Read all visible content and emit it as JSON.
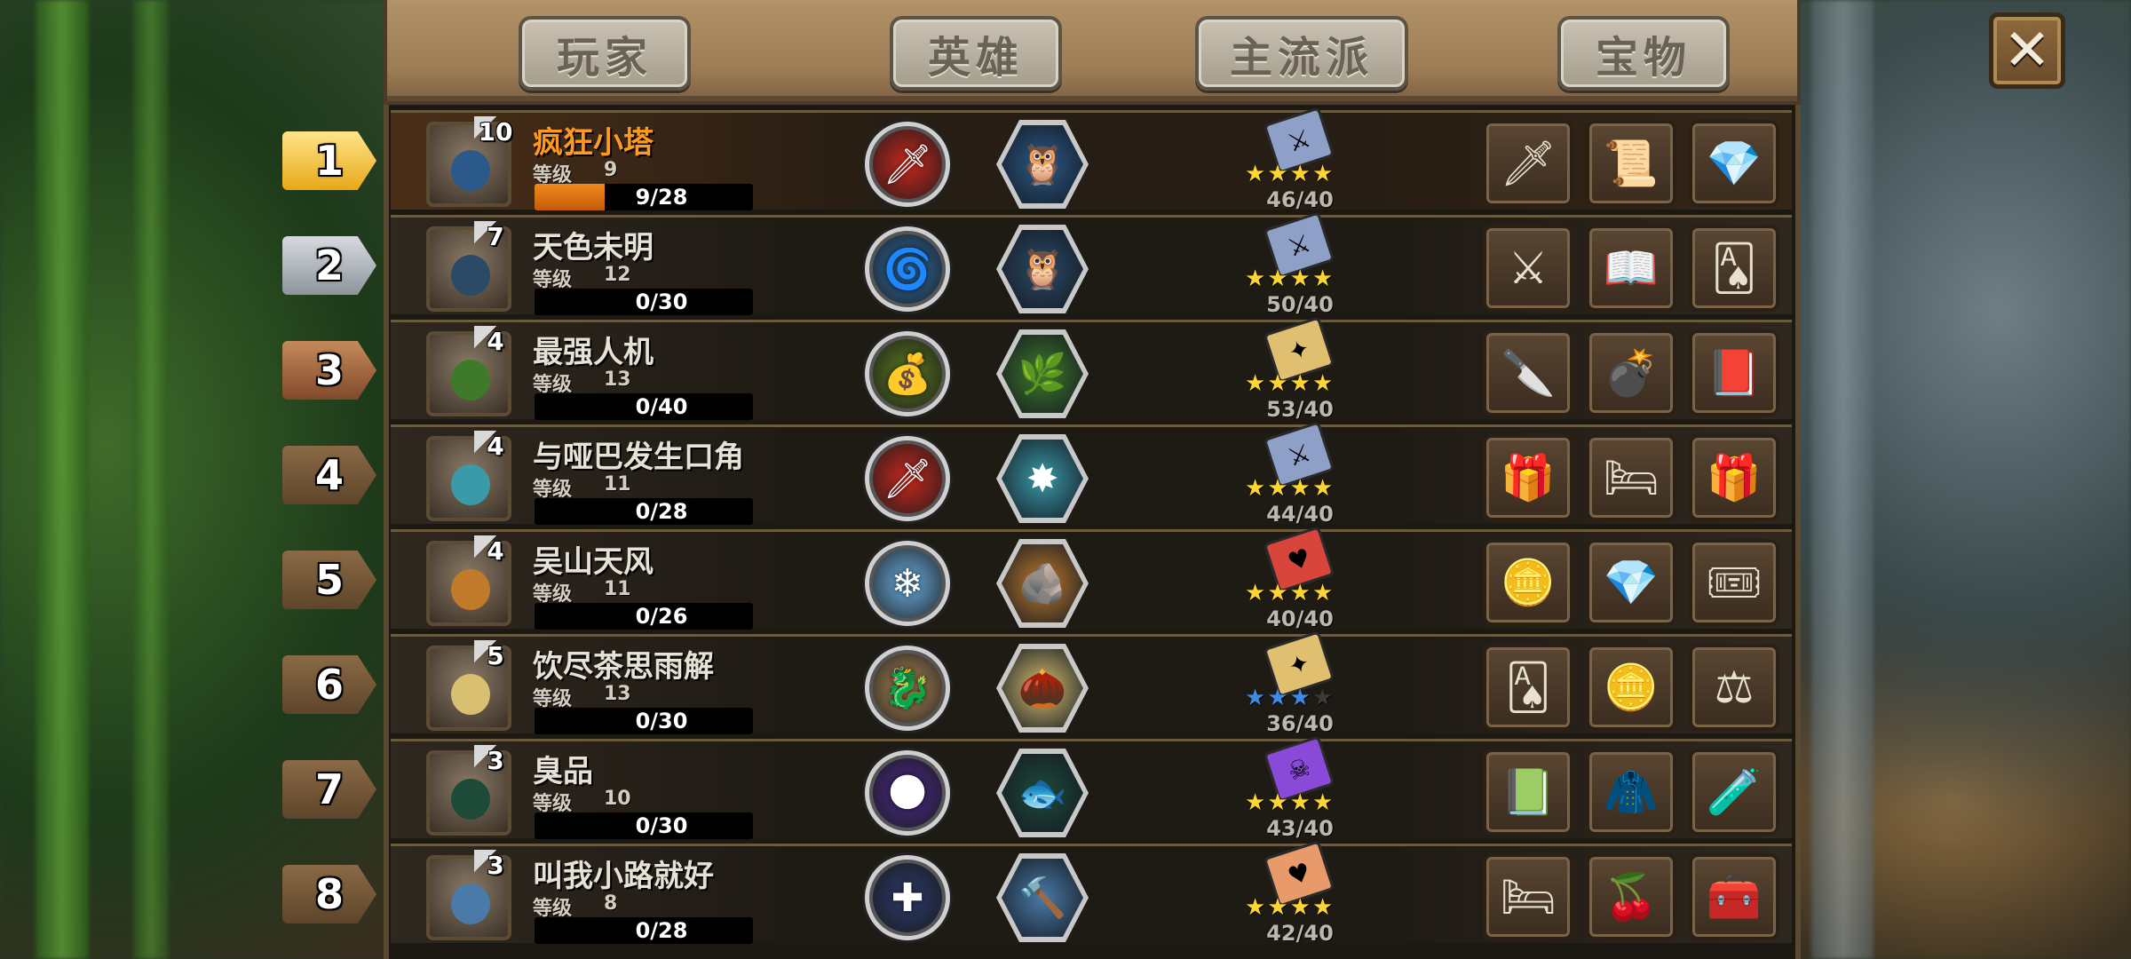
{
  "tabs": [
    "玩家",
    "英雄",
    "主流派",
    "宝物"
  ],
  "close_label": "✕",
  "level_label": "等级",
  "players": [
    {
      "rank": "1",
      "badge": "10",
      "name": "疯狂小塔",
      "level": "9",
      "xp": "9/28",
      "progress": 0.32,
      "highlight": true,
      "skill": "🗡",
      "skill_color": "#c8281e",
      "hero": "🦉",
      "hero_color": "#2b5a8a",
      "book_color": "#8fa0c8",
      "book_icon": "⚔",
      "stars": [
        1,
        1,
        1,
        1
      ],
      "score": "46/40",
      "treasures": [
        "🗡",
        "📜",
        "💎"
      ]
    },
    {
      "rank": "2",
      "badge": "7",
      "name": "天色未明",
      "level": "12",
      "xp": "0/30",
      "progress": 0,
      "skill": "🌀",
      "skill_color": "#2f6fa8",
      "hero": "🦉",
      "hero_color": "#2a4a66",
      "book_color": "#8fa0c8",
      "book_icon": "⚔",
      "stars": [
        1,
        1,
        1,
        1
      ],
      "score": "50/40",
      "treasures": [
        "⚔",
        "📖",
        "🂡"
      ]
    },
    {
      "rank": "3",
      "badge": "4",
      "name": "最强人机",
      "level": "13",
      "xp": "0/40",
      "progress": 0,
      "skill": "💰",
      "skill_color": "#5a7a1e",
      "hero": "🌿",
      "hero_color": "#3e7a2a",
      "book_color": "#e0c070",
      "book_icon": "✦",
      "stars": [
        1,
        1,
        1,
        1
      ],
      "score": "53/40",
      "treasures": [
        "🔪",
        "💣",
        "📕"
      ]
    },
    {
      "rank": "4",
      "badge": "4",
      "name": "与哑巴发生口角",
      "level": "11",
      "xp": "0/28",
      "progress": 0,
      "skill": "🗡",
      "skill_color": "#c8281e",
      "hero": "✸",
      "hero_color": "#3a9aa8",
      "book_color": "#8fa0c8",
      "book_icon": "⚔",
      "stars": [
        1,
        1,
        1,
        1
      ],
      "score": "44/40",
      "treasures": [
        "🎁",
        "🛏",
        "🎁"
      ]
    },
    {
      "rank": "5",
      "badge": "4",
      "name": "吴山天风",
      "level": "11",
      "xp": "0/26",
      "progress": 0,
      "skill": "❄",
      "skill_color": "#6aaee0",
      "hero": "🪨",
      "hero_color": "#c07a2a",
      "book_color": "#d8453a",
      "book_icon": "♥",
      "stars": [
        1,
        1,
        1,
        1
      ],
      "score": "40/40",
      "treasures": [
        "🪙",
        "💎",
        "🎟"
      ]
    },
    {
      "rank": "6",
      "badge": "5",
      "name": "饮尽茶思雨解",
      "level": "13",
      "xp": "0/30",
      "progress": 0,
      "skill": "🐉",
      "skill_color": "#b08a5a",
      "hero": "🌰",
      "hero_color": "#d8c070",
      "book_color": "#e0c070",
      "book_icon": "✦",
      "stars": [
        2,
        2,
        2,
        0
      ],
      "score": "36/40",
      "treasures": [
        "🂡",
        "🪙",
        "⚖"
      ]
    },
    {
      "rank": "7",
      "badge": "3",
      "name": "臭品",
      "level": "10",
      "xp": "0/30",
      "progress": 0,
      "skill": "🌑",
      "skill_color": "#4a2a8a",
      "hero": "🐟",
      "hero_color": "#1e4a3a",
      "book_color": "#8a4ad8",
      "book_icon": "☠",
      "stars": [
        1,
        1,
        1,
        1
      ],
      "score": "43/40",
      "treasures": [
        "📗",
        "🧥",
        "🧪"
      ]
    },
    {
      "rank": "8",
      "badge": "3",
      "name": "叫我小路就好",
      "level": "8",
      "xp": "0/28",
      "progress": 0,
      "skill": "✚",
      "skill_color": "#2a3a6a",
      "hero": "🔨",
      "hero_color": "#4a7aa8",
      "book_color": "#e89a6a",
      "book_icon": "♥",
      "stars": [
        1,
        1,
        1,
        1
      ],
      "score": "42/40",
      "treasures": [
        "🛏",
        "🍒",
        "🧰"
      ]
    }
  ]
}
